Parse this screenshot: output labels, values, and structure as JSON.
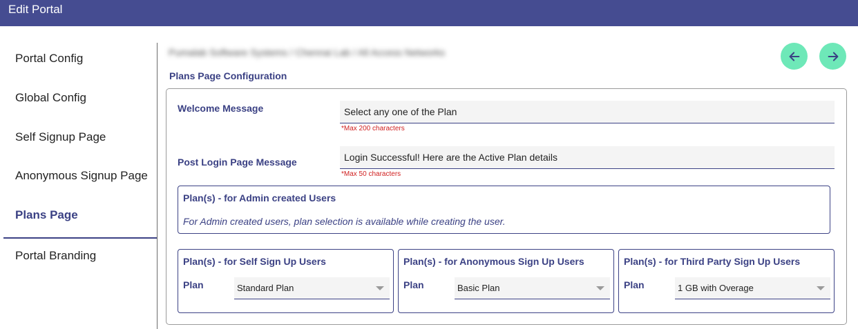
{
  "header": {
    "title": "Edit Portal"
  },
  "sidebar": {
    "items": [
      {
        "label": "Portal Config"
      },
      {
        "label": "Global Config"
      },
      {
        "label": "Self Signup Page"
      },
      {
        "label": "Anonymous Signup Page"
      },
      {
        "label": "Plans Page",
        "active": true
      },
      {
        "label": "Portal Branding"
      }
    ]
  },
  "main": {
    "breadcrumb": "Pumalab Software Systems / Chennai Lab / All Access Networks",
    "section_title": "Plans Page Configuration",
    "nav": {
      "back_icon": "arrow-left-icon",
      "forward_icon": "arrow-right-icon"
    },
    "welcome": {
      "label": "Welcome Message",
      "value": "Select any one of the Plan",
      "hint": "*Max 200 characters"
    },
    "post_login": {
      "label": "Post Login Page Message",
      "value": "Login Successful! Here are the Active Plan details",
      "hint": "*Max 50 characters"
    },
    "admin_plans": {
      "title": "Plan(s) - for Admin created Users",
      "note": "For Admin created users, plan selection is available while creating the user."
    },
    "plan_panels": [
      {
        "title": "Plan(s) - for Self Sign Up Users",
        "plan_label": "Plan",
        "selected": "Standard Plan"
      },
      {
        "title": "Plan(s) - for Anonymous Sign Up Users",
        "plan_label": "Plan",
        "selected": "Basic Plan"
      },
      {
        "title": "Plan(s) - for Third Party Sign Up Users",
        "plan_label": "Plan",
        "selected": "1 GB with Overage"
      }
    ]
  },
  "colors": {
    "header_bg": "#454c91",
    "accent": "#3b4184",
    "button_bg": "#6ee8b8",
    "hint": "#d02020"
  }
}
